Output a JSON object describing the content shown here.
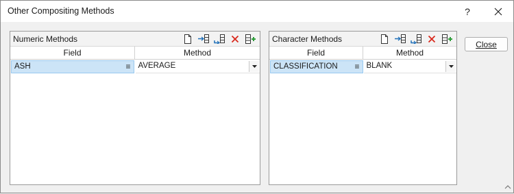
{
  "window": {
    "title": "Other Compositing Methods",
    "help_label": "?"
  },
  "numeric_panel": {
    "title": "Numeric Methods",
    "columns": [
      "Field",
      "Method"
    ],
    "rows": [
      {
        "field": "ASH",
        "method": "AVERAGE"
      }
    ]
  },
  "character_panel": {
    "title": "Character Methods",
    "columns": [
      "Field",
      "Method"
    ],
    "rows": [
      {
        "field": "CLASSIFICATION",
        "method": "BLANK"
      }
    ]
  },
  "toolbar_icons": [
    "new-icon",
    "insert-row-icon",
    "append-row-icon",
    "delete-icon",
    "add-column-icon"
  ],
  "buttons": {
    "close_label": "Close"
  },
  "colors": {
    "selected_cell": "#cce4f7",
    "delete_red": "#d9281c",
    "icon_blue": "#1e6fb8",
    "add_green": "#2e9e3a"
  }
}
